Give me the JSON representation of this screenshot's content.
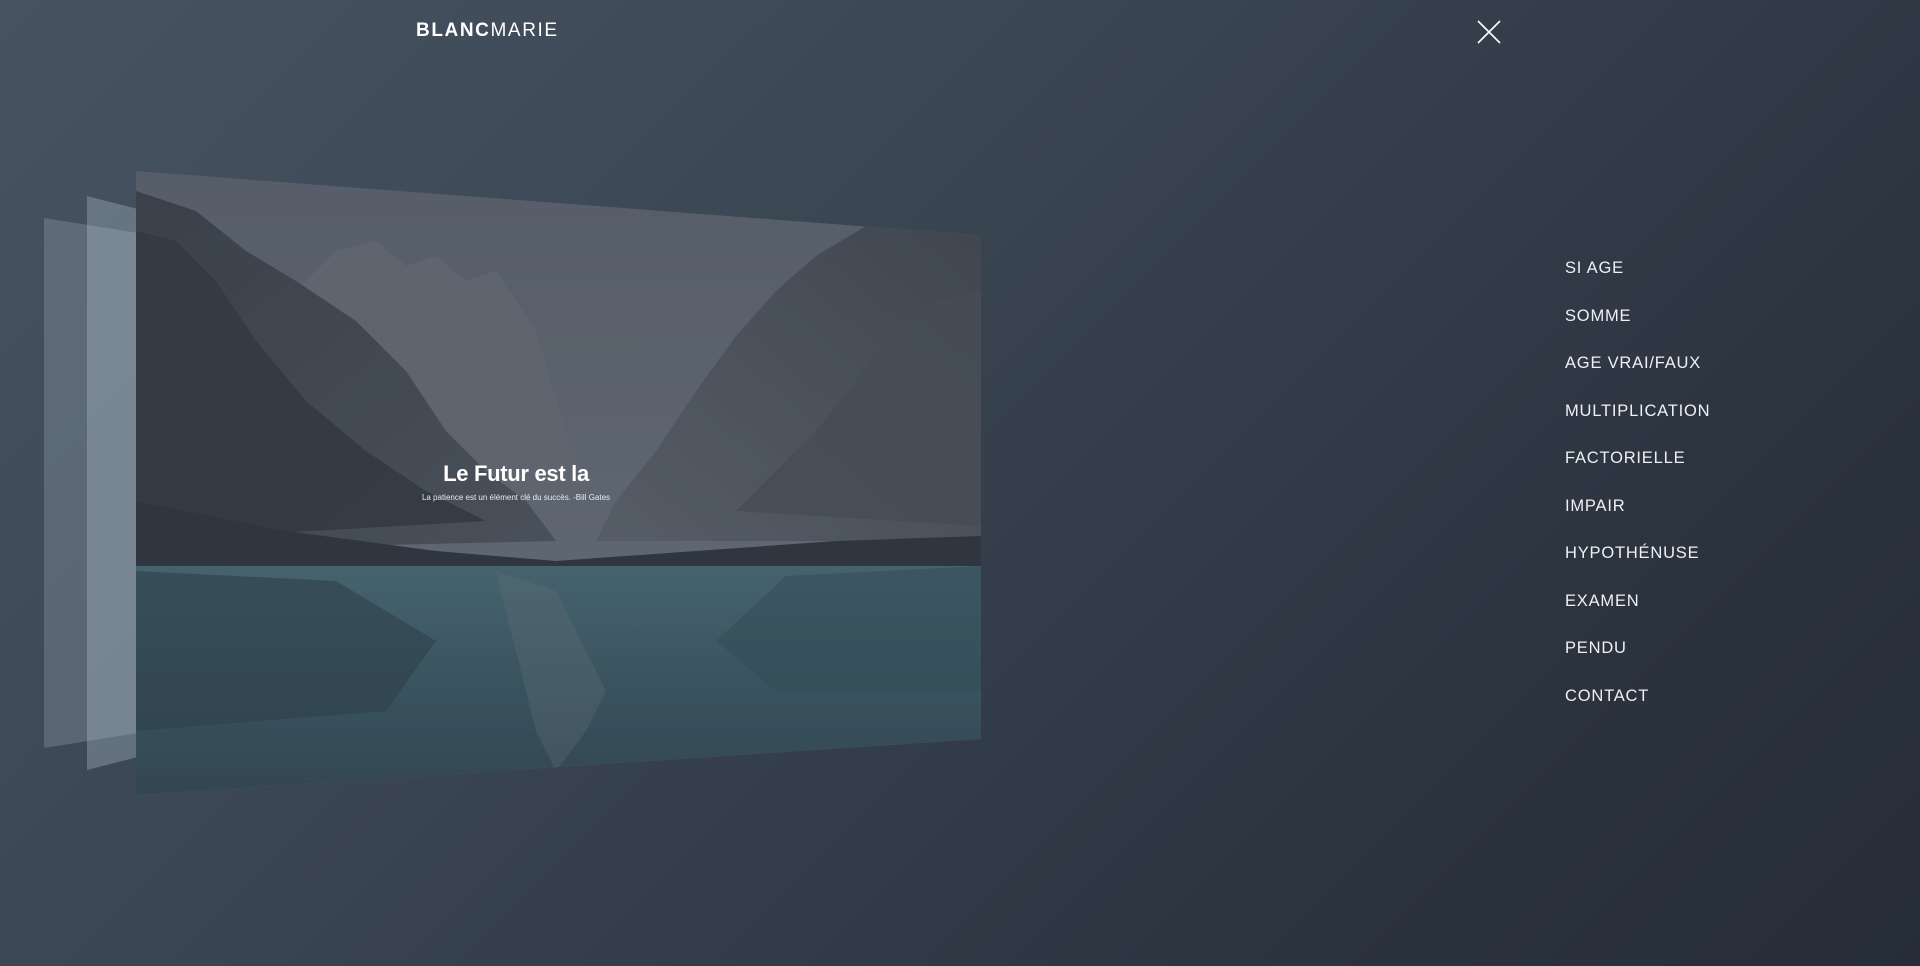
{
  "header": {
    "logo_bold": "BLANC",
    "logo_light": "MARIE",
    "close_icon": "close-icon"
  },
  "slider": {
    "title": "Le Futur est la",
    "quote": "La patience est un élément clé du succès. -Bill Gates"
  },
  "menu": {
    "items": [
      {
        "label": "SI AGE"
      },
      {
        "label": "SOMME"
      },
      {
        "label": "AGE VRAI/FAUX"
      },
      {
        "label": "MULTIPLICATION"
      },
      {
        "label": "FACTORIELLE"
      },
      {
        "label": "IMPAIR"
      },
      {
        "label": "HYPOTHÉNUSE"
      },
      {
        "label": "EXAMEN"
      },
      {
        "label": "PENDU"
      },
      {
        "label": "CONTACT"
      }
    ]
  },
  "colors": {
    "background_start": "#475361",
    "background_end": "#262d38",
    "text": "#ffffff",
    "water": "#3c5e68"
  }
}
